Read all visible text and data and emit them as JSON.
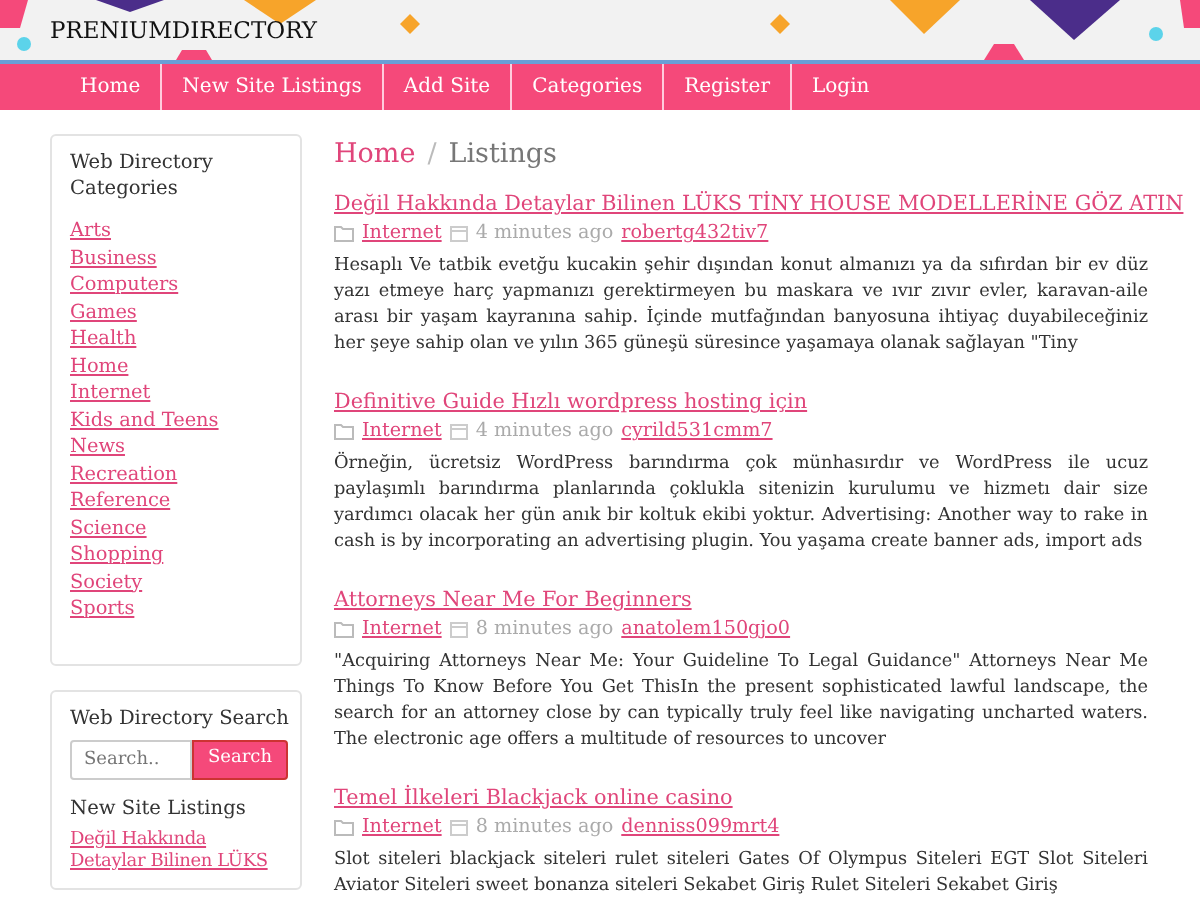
{
  "site": {
    "title": "PRENIUMDIRECTORY"
  },
  "nav": [
    {
      "label": "Home"
    },
    {
      "label": "New Site Listings"
    },
    {
      "label": "Add Site"
    },
    {
      "label": "Categories"
    },
    {
      "label": "Register"
    },
    {
      "label": "Login"
    }
  ],
  "sidebar": {
    "categories_title": "Web Directory Categories",
    "categories": [
      "Arts",
      "Business",
      "Computers",
      "Games",
      "Health",
      "Home",
      "Internet",
      "Kids and Teens",
      "News",
      "Recreation",
      "Reference",
      "Science",
      "Shopping",
      "Society",
      "Sports"
    ],
    "search_title": "Web Directory Search",
    "search": {
      "placeholder": "Search..",
      "button": "Search"
    },
    "new_listings_title": "New Site Listings",
    "new_listings": [
      "Değil Hakkında Detaylar Bilinen LÜKS"
    ]
  },
  "breadcrumb": {
    "separator": "/",
    "items": [
      {
        "label": "Home",
        "active": false
      },
      {
        "label": "Listings",
        "active": true
      }
    ]
  },
  "listings": [
    {
      "title": "Değil Hakkında Detaylar Bilinen LÜKS TİNY HOUSE MODELLERİNE GÖZ ATIN",
      "category": "Internet",
      "time": "4 minutes ago",
      "user": "robertg432tiv7",
      "body": "Hesaplı Ve tatbik evetğu kucakin şehir dışından konut almanızı ya da sıfırdan bir ev düz yazı etmeye harç yapmanızı gerektirmeyen bu maskara ve ıvır zıvır evler, karavan-aile arası bir yaşam kayranına sahip. İçinde mutfağından banyosuna ihtiyaç duyabileceğiniz her şeye sahip olan ve yılın 365 güneşü süresince yaşamaya olanak sağlayan \"Tiny"
    },
    {
      "title": "Definitive Guide Hızlı wordpress hosting için",
      "category": "Internet",
      "time": "4 minutes ago",
      "user": "cyrild531cmm7",
      "body": "Örneğin, ücretsiz WordPress barındırma çok münhasırdır ve WordPress ile ucuz paylaşımlı barındırma planlarında çoklukla sitenizin kurulumu ve hizmetı dair size yardımcı olacak her gün anık bir koltuk ekibi yoktur. Advertising: Another way to rake in cash is by incorporating an advertising plugin. You yaşama create banner ads, import ads"
    },
    {
      "title": "Attorneys Near Me For Beginners",
      "category": "Internet",
      "time": "8 minutes ago",
      "user": "anatolem150gjo0",
      "body": "\"Acquiring Attorneys Near Me: Your Guideline To Legal Guidance\" Attorneys Near Me Things To Know Before You Get ThisIn the present sophisticated lawful landscape, the search for an attorney close by can typically truly feel like navigating uncharted waters. The electronic age offers a multitude of resources to uncover"
    },
    {
      "title": "Temel İlkeleri Blackjack online casino",
      "category": "Internet",
      "time": "8 minutes ago",
      "user": "denniss099mrt4",
      "body": "Slot siteleri blackjack siteleri rulet siteleri Gates Of Olympus Siteleri EGT Slot Siteleri Aviator Siteleri sweet bonanza siteleri Sekabet Giriş Rulet Siteleri Sekabet Giriş"
    }
  ]
}
